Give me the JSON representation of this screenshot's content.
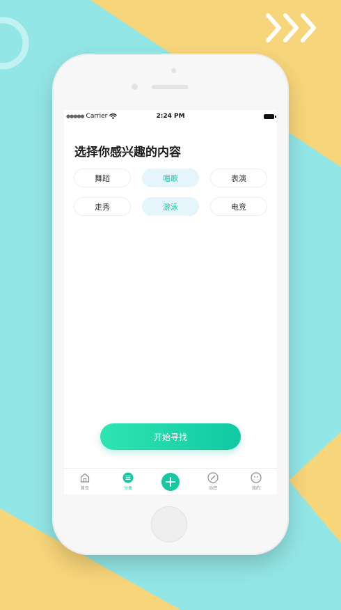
{
  "status_bar": {
    "carrier": "Carrier",
    "time": "2:24 PM"
  },
  "page": {
    "title": "选择你感兴趣的内容"
  },
  "tags": [
    {
      "label": "舞蹈",
      "selected": false
    },
    {
      "label": "唱歌",
      "selected": true
    },
    {
      "label": "表演",
      "selected": false
    },
    {
      "label": "走秀",
      "selected": false
    },
    {
      "label": "游泳",
      "selected": true
    },
    {
      "label": "电竞",
      "selected": false
    }
  ],
  "start_button": {
    "label": "开始寻找"
  },
  "tabbar": {
    "home": "首页",
    "category": "分类",
    "activity": "动态",
    "mine": "我的"
  },
  "colors": {
    "accent": "#1ec6a5",
    "selected_bg": "#e6f5fc",
    "bg_cyan": "#93e6e6",
    "bg_yellow": "#f7d57a"
  },
  "icons": [
    "home-icon",
    "list-icon",
    "plus-icon",
    "compass-icon",
    "profile-icon"
  ]
}
